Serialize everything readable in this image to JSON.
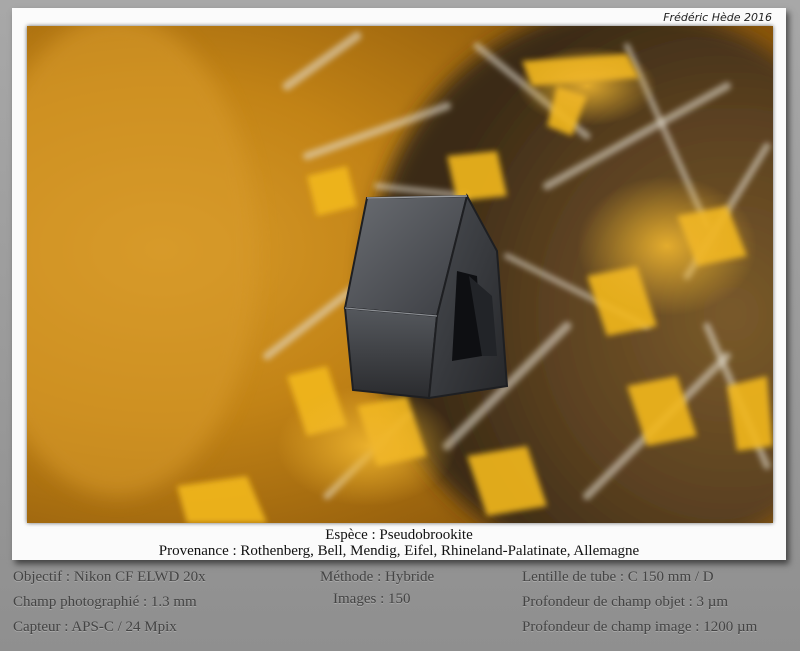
{
  "credit": "Frédéric Hède 2016",
  "caption": {
    "species": "Espèce : Pseudobrookite",
    "provenance": "Provenance : Rothenberg, Bell, Mendig, Eifel, Rhineland-Palatinate, Allemagne"
  },
  "details": {
    "left": [
      "Objectif : Nikon CF ELWD 20x",
      "Champ photographié : 1.3 mm",
      "Capteur : APS-C / 24 Mpix"
    ],
    "middle": [
      "Méthode : Hybride",
      "Images : 150"
    ],
    "right": [
      "Lentille de tube : C 150 mm / D",
      "Profondeur de champ objet : 3 µm",
      "Profondeur de champ image : 1200 µm"
    ]
  },
  "colors": {
    "background": "#9a9a9a",
    "card": "#fbfbfb",
    "amber": "#c98a14",
    "crystal": "#3c3c3e"
  }
}
